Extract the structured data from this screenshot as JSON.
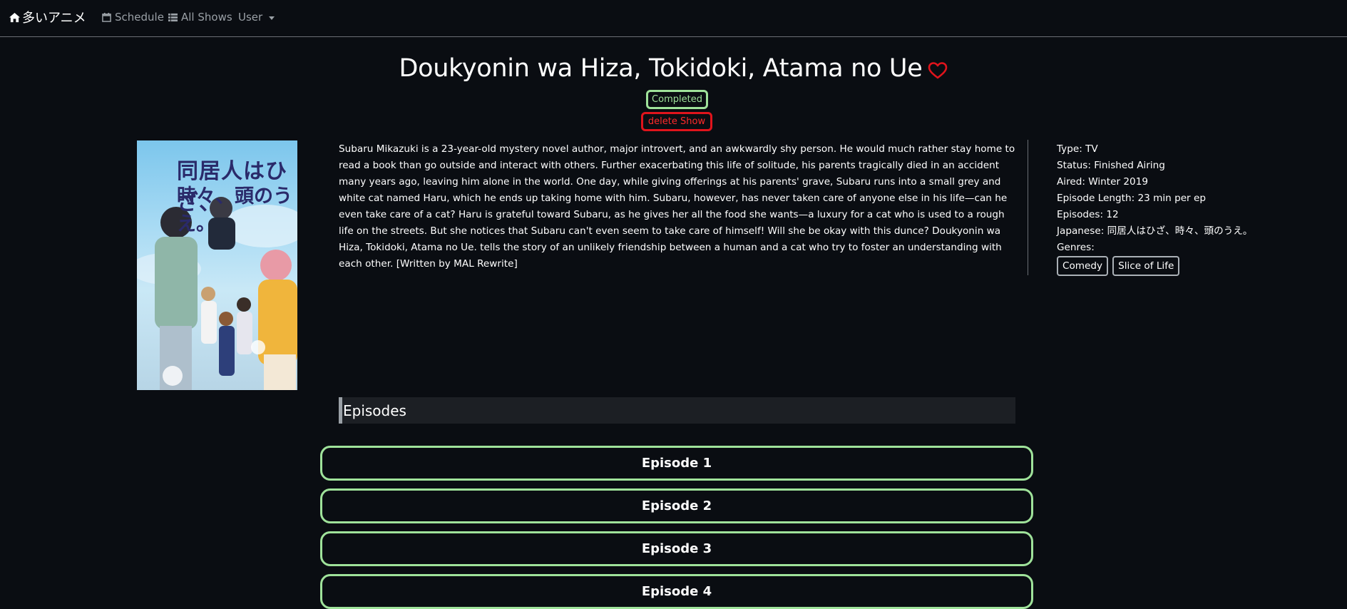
{
  "nav": {
    "brand": "多いアニメ",
    "schedule": "Schedule",
    "all_shows": "All Shows",
    "user": "User"
  },
  "show": {
    "title": "Doukyonin wa Hiza, Tokidoki, Atama no Ue",
    "status_badge": "Completed",
    "delete_label": "delete Show",
    "poster_text_line1": "同居人はひざ、",
    "poster_text_line2": "時々、頭のうえ。",
    "synopsis": "Subaru Mikazuki is a 23-year-old mystery novel author, major introvert, and an awkwardly shy person. He would much rather stay home to read a book than go outside and interact with others. Further exacerbating this life of solitude, his parents tragically died in an accident many years ago, leaving him alone in the world. One day, while giving offerings at his parents' grave, Subaru runs into a small grey and white cat named Haru, which he ends up taking home with him. Subaru, however, has never taken care of anyone else in his life—can he even take care of a cat? Haru is grateful toward Subaru, as he gives her all the food she wants—a luxury for a cat who is used to a rough life on the streets. But she notices that Subaru can't even seem to take care of himself! Will she be okay with this dunce? Doukyonin wa Hiza, Tokidoki, Atama no Ue. tells the story of an unlikely friendship between a human and a cat who try to foster an understanding with each other. [Written by MAL Rewrite]"
  },
  "info": {
    "type": "Type: TV",
    "status": "Status: Finished Airing",
    "aired": "Aired: Winter 2019",
    "episode_length": "Episode Length: 23 min per ep",
    "episodes": "Episodes: 12",
    "japanese": "Japanese: 同居人はひざ、時々、頭のうえ。",
    "genres_label": "Genres:",
    "genres": [
      "Comedy",
      "Slice of Life"
    ]
  },
  "episodes_section": {
    "header": "Episodes",
    "items": [
      "Episode 1",
      "Episode 2",
      "Episode 3",
      "Episode 4"
    ]
  },
  "colors": {
    "background": "#0a0d12",
    "accent_green": "#9fe29a",
    "danger_red": "#e0141c"
  },
  "icons": {
    "brand": "home-icon",
    "schedule": "calendar-icon",
    "all_shows": "list-icon",
    "favorite": "heart-outline-icon"
  }
}
